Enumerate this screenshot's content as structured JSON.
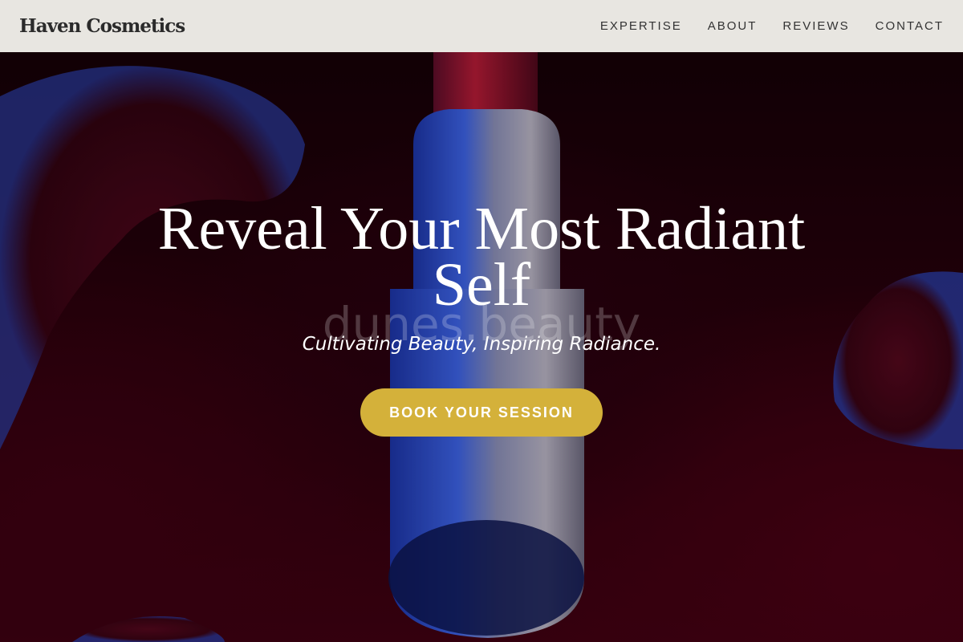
{
  "header": {
    "brand": "Haven Cosmetics",
    "nav": [
      {
        "label": "EXPERTISE"
      },
      {
        "label": "ABOUT"
      },
      {
        "label": "REVIEWS"
      },
      {
        "label": "CONTACT"
      }
    ]
  },
  "hero": {
    "headline": "Reveal Your Most Radiant Self",
    "watermark": "dunes.beauty",
    "tagline": "Cultivating Beauty, Inspiring Radiance.",
    "cta_label": "BOOK YOUR SESSION"
  },
  "colors": {
    "header_bg": "#e8e6e1",
    "cta_bg": "#d4b13a",
    "hero_bg": "#2a000c",
    "text_light": "#ffffff"
  }
}
